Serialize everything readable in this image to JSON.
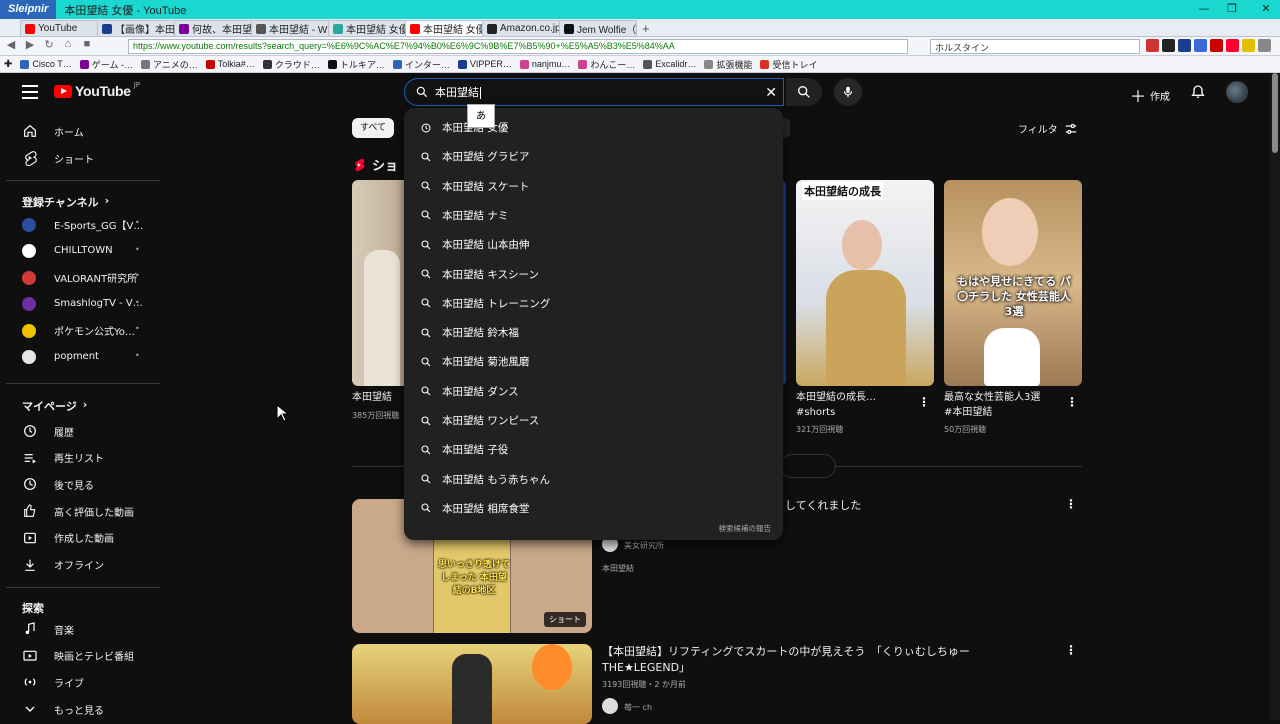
{
  "window": {
    "brand": "Sleipnir",
    "title": "本田望結 女優 - YouTube",
    "controls": [
      "—",
      "❐",
      "✕"
    ]
  },
  "tabs": [
    {
      "label": "YouTube",
      "color": "#ff0000",
      "active": false
    },
    {
      "label": "【画像】本田ぼう…",
      "color": "#1a3d8f",
      "active": false
    },
    {
      "label": "何故、本田望結…",
      "color": "#7b0099",
      "active": false
    },
    {
      "label": "本田望結 - Wiki…",
      "color": "#555555",
      "active": false
    },
    {
      "label": "本田望結 女優 -…",
      "color": "#2aa6a0",
      "active": false
    },
    {
      "label": "本田望結 女優 -…",
      "color": "#ff0000",
      "active": true
    },
    {
      "label": "Amazon.co.jp :…",
      "color": "#222222",
      "active": false
    },
    {
      "label": "Jem Wolfie（@l…",
      "color": "#111111",
      "active": false
    }
  ],
  "tab_new": "+",
  "address": {
    "url": "https://www.youtube.com/results?search_query=%E6%9C%AC%E7%94%B0%E6%9C%9B%E7%B5%90+%E5%A5%B3%E5%84%AA",
    "search_engine_text": "ホルスタイン"
  },
  "bookmarks": [
    {
      "label": "Cisco T…",
      "color": "#2b66b9"
    },
    {
      "label": "ゲーム -…",
      "color": "#7b0099"
    },
    {
      "label": "アニメの…",
      "color": "#777777"
    },
    {
      "label": "Tolkia#…",
      "color": "#cc0000"
    },
    {
      "label": "クラウド…",
      "color": "#333333"
    },
    {
      "label": "トルキア…",
      "color": "#111111"
    },
    {
      "label": "インター…",
      "color": "#2b66b9"
    },
    {
      "label": "VIPPER…",
      "color": "#1a3d8f"
    },
    {
      "label": "nanjmu…",
      "color": "#d13f8f"
    },
    {
      "label": "わんこー…",
      "color": "#d13f8f"
    },
    {
      "label": "Excalidr…",
      "color": "#555555"
    },
    {
      "label": "拡張機能",
      "color": "#888888"
    },
    {
      "label": "受信トレイ",
      "color": "#d93025"
    }
  ],
  "youtube": {
    "logo": "YouTube",
    "logo_region": "JP",
    "search_value": "本田望結",
    "ime_char": "あ",
    "create_label": "作成",
    "sidebar": {
      "home": "ホーム",
      "shorts": "ショート",
      "subs_header": "登録チャンネル",
      "channels": [
        {
          "name": "E-Sports_GG【V…",
          "color": "#2b4ea0"
        },
        {
          "name": "CHILLTOWN",
          "color": "#ffffff"
        },
        {
          "name": "VALORANT研究所",
          "color": "#d23a3a"
        },
        {
          "name": "SmashlogTV - V…",
          "color": "#6b2fa0"
        },
        {
          "name": "ポケモン公式Yo…",
          "color": "#f2c200"
        },
        {
          "name": "popment",
          "color": "#e6e6e6"
        }
      ],
      "you_header": "マイページ",
      "you_items": [
        "履歴",
        "再生リスト",
        "後で見る",
        "高く評価した動画",
        "作成した動画",
        "オフライン"
      ],
      "explore_header": "探索",
      "explore_items": [
        "音楽",
        "映画とテレビ番組",
        "ライブ",
        "もっと見る"
      ]
    },
    "chips": {
      "all": "すべて"
    },
    "filter_label": "フィルタ",
    "shorts_header": "ショ",
    "shorts": [
      {
        "title": "本田望結",
        "views": "385万回視聴"
      },
      {
        "title": "本田望結の成長…",
        "hashtag": "#shorts",
        "views": "321万回視聴",
        "overlay": "本田望結の成長"
      },
      {
        "title": "最高な女性芸能人3選",
        "hashtag": "#本田望結",
        "views": "50万回視聴",
        "overlay": "もはや見せにきてる パ〇チラした 女性芸能人 3選"
      }
    ],
    "videos": [
      {
        "title": "してくれました",
        "channel": "美女研究所",
        "desc": "本田望結",
        "badge": "ショート",
        "overlay": "思いっきり透けてしまった 本田望結のB地区"
      },
      {
        "title": "【本田望結】リフティングでスカートの中が見えそう　「くりぃむしちゅーTHE★LEGEND」",
        "meta": "3193回視聴・2 か月前",
        "channel": "苺一 ch"
      }
    ],
    "suggestions": [
      {
        "text": "本田望結 女優",
        "history": true
      },
      {
        "text": "本田望結 グラビア"
      },
      {
        "text": "本田望結 スケート"
      },
      {
        "text": "本田望結 ナミ"
      },
      {
        "text": "本田望結 山本由伸"
      },
      {
        "text": "本田望結 キスシーン"
      },
      {
        "text": "本田望結 トレーニング"
      },
      {
        "text": "本田望結 鈴木福"
      },
      {
        "text": "本田望結 菊池風磨"
      },
      {
        "text": "本田望結 ダンス"
      },
      {
        "text": "本田望結 ワンピース"
      },
      {
        "text": "本田望結 子役"
      },
      {
        "text": "本田望結 もう赤ちゃん"
      },
      {
        "text": "本田望結 相席食堂"
      }
    ],
    "report_label": "検索候補の報告"
  }
}
